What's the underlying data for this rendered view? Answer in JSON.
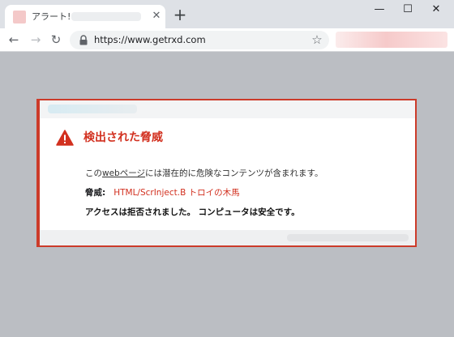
{
  "browser": {
    "tab": {
      "title": "アラート! -",
      "close_glyph": "✕"
    },
    "new_tab_glyph": "+",
    "window_controls": {
      "minimize": "—",
      "maximize": "☐",
      "close": "✕"
    },
    "toolbar": {
      "back_glyph": "←",
      "forward_glyph": "→",
      "reload_glyph": "↻",
      "url": "https://www.getrxd.com",
      "bookmark_glyph": "☆"
    }
  },
  "alert": {
    "title": "検出された脅威",
    "description_prefix": "この",
    "description_link": "webページ",
    "description_suffix": "には潜在的に危険なコンテンツが含まれます。",
    "threat_label": "脅威:",
    "threat_name": "HTML/ScrInject.B トロイの木馬",
    "access_message": "アクセスは拒否されました。 コンピュータは安全です。",
    "colors": {
      "accent": "#d2301f",
      "border": "#cc3b2a"
    }
  }
}
